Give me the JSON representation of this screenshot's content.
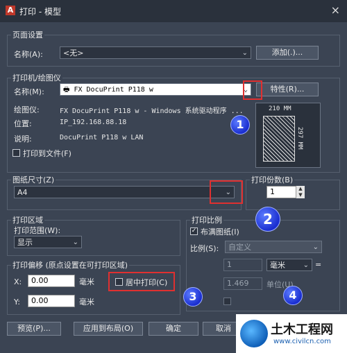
{
  "window": {
    "title": "打印 - 模型",
    "close": "×"
  },
  "page_setup": {
    "group_label": "页面设置",
    "name_label": "名称(A):",
    "name_value": "<无>",
    "add_button": "添加(.)..."
  },
  "printer": {
    "group_label": "打印机/绘图仪",
    "name_label": "名称(M):",
    "name_value": "FX DocuPrint P118 w",
    "properties_button": "特性(R)...",
    "plotter_label": "绘图仪:",
    "plotter_value": "FX DocuPrint P118 w - Windows 系统驱动程序 ...",
    "location_label": "位置:",
    "location_value": "IP_192.168.88.18",
    "desc_label": "说明:",
    "desc_value": "DocuPrint P118 w LAN",
    "print_to_file": "打印到文件(F)",
    "paper_width": "210 MM",
    "paper_height": "297 MM"
  },
  "paper": {
    "group_label": "图纸尺寸(Z)",
    "value": "A4"
  },
  "copies": {
    "label": "打印份数(B)",
    "value": "1"
  },
  "area": {
    "group_label": "打印区域",
    "range_label": "打印范围(W):",
    "range_value": "显示"
  },
  "scale": {
    "group_label": "打印比例",
    "fit_paper": "布满图纸(I)",
    "scale_label": "比例(S):",
    "scale_value": "自定义",
    "value1": "1",
    "unit1": "毫米",
    "equals": "=",
    "value2": "1.469",
    "unit2": "单位(U)"
  },
  "offset": {
    "group_label": "打印偏移 (原点设置在可打印区域)",
    "x_label": "X:",
    "x_value": "0.00",
    "x_unit": "毫米",
    "y_label": "Y:",
    "y_value": "0.00",
    "y_unit": "毫米",
    "center": "居中打印(C)"
  },
  "footer": {
    "preview": "预览(P)...",
    "apply": "应用到布局(O)",
    "ok": "确定",
    "cancel": "取消"
  },
  "badges": [
    "1",
    "2",
    "3",
    "4"
  ],
  "watermark": {
    "title": "土木工程网",
    "url": "www.civilcn.com"
  },
  "colors": {
    "accent_red": "#e03030",
    "badge_blue": "#1a2ed0",
    "dialog_bg": "#3b4453"
  }
}
